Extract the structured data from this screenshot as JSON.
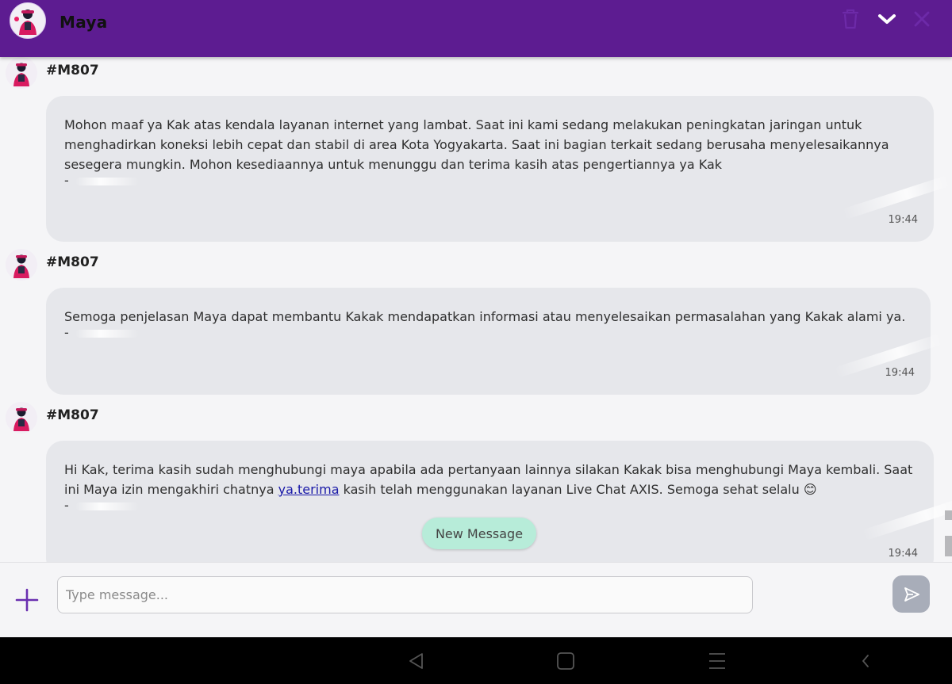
{
  "header": {
    "title": "Maya",
    "icons": [
      "avatar-icon",
      "trash-icon",
      "chevron-down-icon",
      "close-icon"
    ]
  },
  "messages": [
    {
      "sender": "#M807",
      "text": "Mohon maaf ya Kak atas kendala layanan internet yang lambat. Saat ini kami sedang melakukan peningkatan jaringan untuk menghadirkan koneksi lebih cepat dan stabil di area Kota Yogyakarta. Saat ini bagian terkait sedang berusaha menyelesaikannya sesegera mungkin. Mohon kesediaannya untuk menunggu dan terima kasih atas pengertiannya ya Kak",
      "signature": "-",
      "time": "19:44"
    },
    {
      "sender": "#M807",
      "text": "Semoga penjelasan Maya dapat membantu Kakak mendapatkan informasi atau menyelesaikan permasalahan yang Kakak alami ya.",
      "signature": "-",
      "time": "19:44"
    },
    {
      "sender": "#M807",
      "text_before": "Hi Kak, terima kasih sudah menghubungi maya apabila ada pertanyaan lainnya silakan Kakak bisa menghubungi Maya kembali. Saat ini Maya izin mengakhiri chatnya ",
      "link": "ya.terima",
      "text_after": " kasih telah menggunakan layanan Live Chat AXIS. Semoga sehat selalu",
      "emoji": "😊",
      "signature": "-",
      "time": "19:44"
    }
  ],
  "new_message_label": "New Message",
  "composer": {
    "placeholder": "Type message..."
  },
  "colors": {
    "header": "#5d1c91",
    "bubble": "#e6e7eb",
    "new_message": "#b7ecd9",
    "send_button": "#a8adb9",
    "accent": "#6a2fb0"
  }
}
